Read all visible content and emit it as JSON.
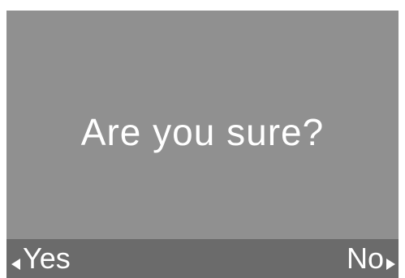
{
  "dialog": {
    "message": "Are you sure?"
  },
  "softkeys": {
    "left_label": "Yes",
    "left_icon": "left-triangle-arrow",
    "right_label": "No",
    "right_icon": "right-triangle-arrow"
  },
  "colors": {
    "screen_background": "#909090",
    "softkey_bar_background": "#6b6b6b",
    "text": "#ffffff"
  }
}
